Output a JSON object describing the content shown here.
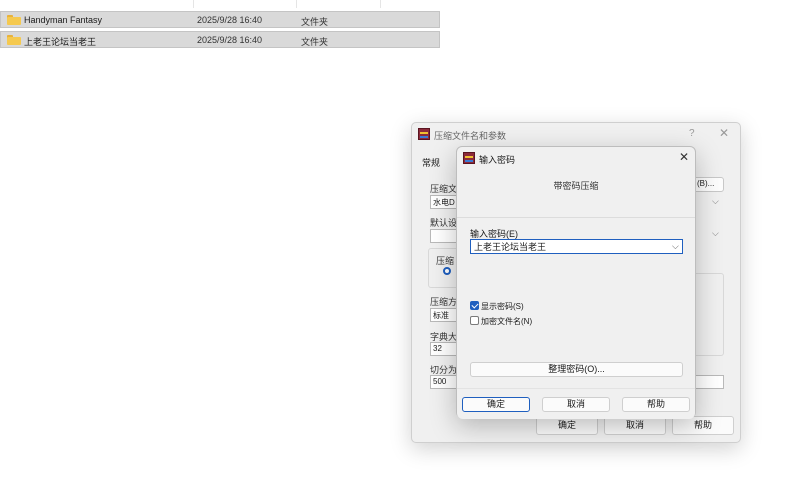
{
  "file_list": {
    "rows": [
      {
        "name": "Handyman Fantasy",
        "date": "2025/9/28 16:40",
        "type": "文件夹"
      },
      {
        "name": "上老王论坛当老王",
        "date": "2025/9/28 16:40",
        "type": "文件夹"
      }
    ]
  },
  "back_dialog": {
    "title": "压缩文件名和参数",
    "help_glyph": "?",
    "close_glyph": "✕",
    "tab_general": "常规",
    "archive_name_label": "压缩文",
    "archive_name_value": "水电D",
    "browse_button": "(B)...",
    "default_settings_label": "默认设",
    "format_label": "压缩",
    "method_label": "压缩方",
    "method_value": "标准",
    "dict_label": "字典大",
    "dict_value": "32",
    "split_label": "切分为",
    "split_value": "500",
    "ok": "确定",
    "cancel": "取消",
    "help": "帮助"
  },
  "password_dialog": {
    "title": "输入密码",
    "close_glyph": "✕",
    "subtitle": "带密码压缩",
    "password_label": "输入密码(E)",
    "password_value": "上老王论坛当老王",
    "show_password_label": "显示密码(S)",
    "show_password_checked": true,
    "encrypt_filenames_label": "加密文件名(N)",
    "encrypt_filenames_checked": false,
    "organize_button": "整理密码(O)...",
    "ok": "确定",
    "cancel": "取消",
    "help": "帮助"
  },
  "colors": {
    "accent": "#1f5fbf",
    "selected_row": "#d9d9d9",
    "dialog_bg": "#f0f0f0"
  },
  "icons": {
    "folder": "folder-icon",
    "app": "winrar-icon",
    "dropdown": "chevron-down-icon",
    "close": "close-icon",
    "help": "help-icon"
  }
}
